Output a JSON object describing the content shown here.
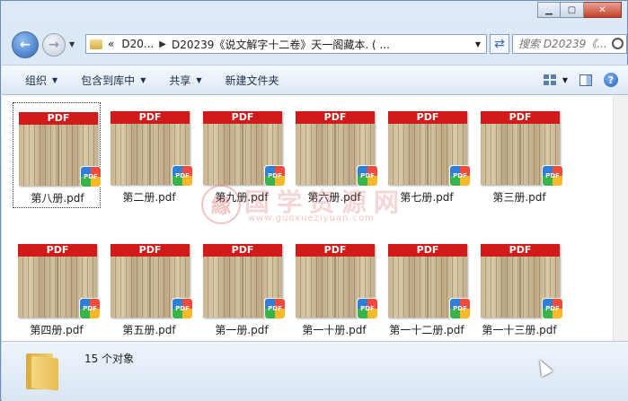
{
  "window": {
    "caption_buttons": [
      "minimize",
      "maximize",
      "close"
    ]
  },
  "nav": {
    "back_icon": "back-arrow-icon",
    "forward_icon": "forward-arrow-icon",
    "breadcrumb_prefix": "«",
    "crumb1": "D20...",
    "crumb2": "D20239《说文解字十二卷》天一阁藏本. ( ...",
    "search_placeholder": "搜索 D20239《..."
  },
  "toolbar": {
    "organize": "组织",
    "include_library": "包含到库中",
    "share": "共享",
    "new_folder": "新建文件夹"
  },
  "pdf_badge": "PDF",
  "thumb_label": "PDF",
  "files": [
    {
      "name": "第八册.pdf",
      "selected": true
    },
    {
      "name": "第二册.pdf",
      "selected": false
    },
    {
      "name": "第九册.pdf",
      "selected": false
    },
    {
      "name": "第六册.pdf",
      "selected": false
    },
    {
      "name": "第七册.pdf",
      "selected": false
    },
    {
      "name": "第三册.pdf",
      "selected": false
    },
    {
      "name": "第四册.pdf",
      "selected": false
    },
    {
      "name": "第五册.pdf",
      "selected": false
    },
    {
      "name": "第一册.pdf",
      "selected": false
    },
    {
      "name": "第一十册.pdf",
      "selected": false
    },
    {
      "name": "第一十二册.pdf",
      "selected": false
    },
    {
      "name": "第一十三册.pdf",
      "selected": false
    }
  ],
  "watermark": {
    "seal": "緣",
    "title": "国学资源网",
    "url": "www.guoxueziyuan.com"
  },
  "details": {
    "count": "15 个对象"
  },
  "colors": {
    "pdf_red": "#d11a1a",
    "window_frame": "#6d8fb5",
    "toolbar_bg": "#e6eef8"
  }
}
